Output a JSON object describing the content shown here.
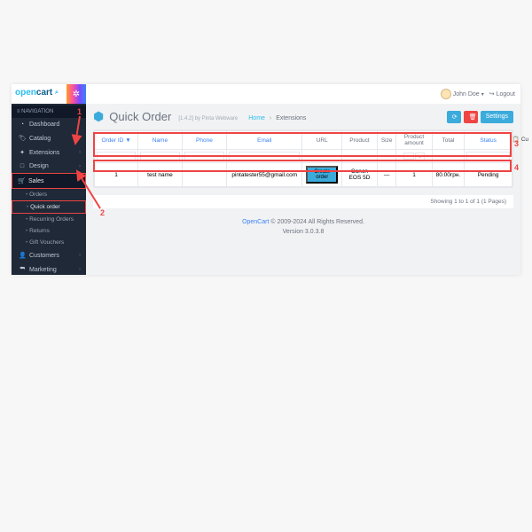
{
  "header": {
    "user": "John Doe",
    "logout": "Logout"
  },
  "sidebar": {
    "title": "NAVIGATION",
    "items": [
      "Dashboard",
      "Catalog",
      "Extensions",
      "Design",
      "Sales",
      "Customers",
      "Marketing"
    ],
    "subs": [
      "Orders",
      "Quick order",
      "Recurring Orders",
      "Returns",
      "Gift Vouchers"
    ]
  },
  "page": {
    "title": "Quick Order",
    "subtitle": "[1.4.2] by Pinta Webware",
    "bc_home": "Home",
    "bc_cur": "Extensions",
    "btn_settings": "Settings"
  },
  "table": {
    "headers": [
      "Order ID ▼",
      "Name",
      "Phone",
      "Email",
      "URL",
      "Product",
      "Size",
      "Product amount",
      "Total",
      "Status",
      "Cu"
    ],
    "row": {
      "id": "1",
      "name": "test name",
      "email": "pintatester55@gmail.com",
      "url_btn": "Create order",
      "product": "Canon EOS 5D",
      "size": "—",
      "amount": "1",
      "total": "80.00грн.",
      "status": "Pending"
    },
    "pager": "Showing 1 to 1 of 1 (1 Pages)"
  },
  "footer": {
    "brand": "OpenCart",
    "copy": " © 2009-2024 All Rights Reserved.",
    "ver": "Version 3.0.3.8"
  },
  "anno": {
    "a1": "1",
    "a2": "2",
    "a3": "3",
    "a4": "4"
  }
}
